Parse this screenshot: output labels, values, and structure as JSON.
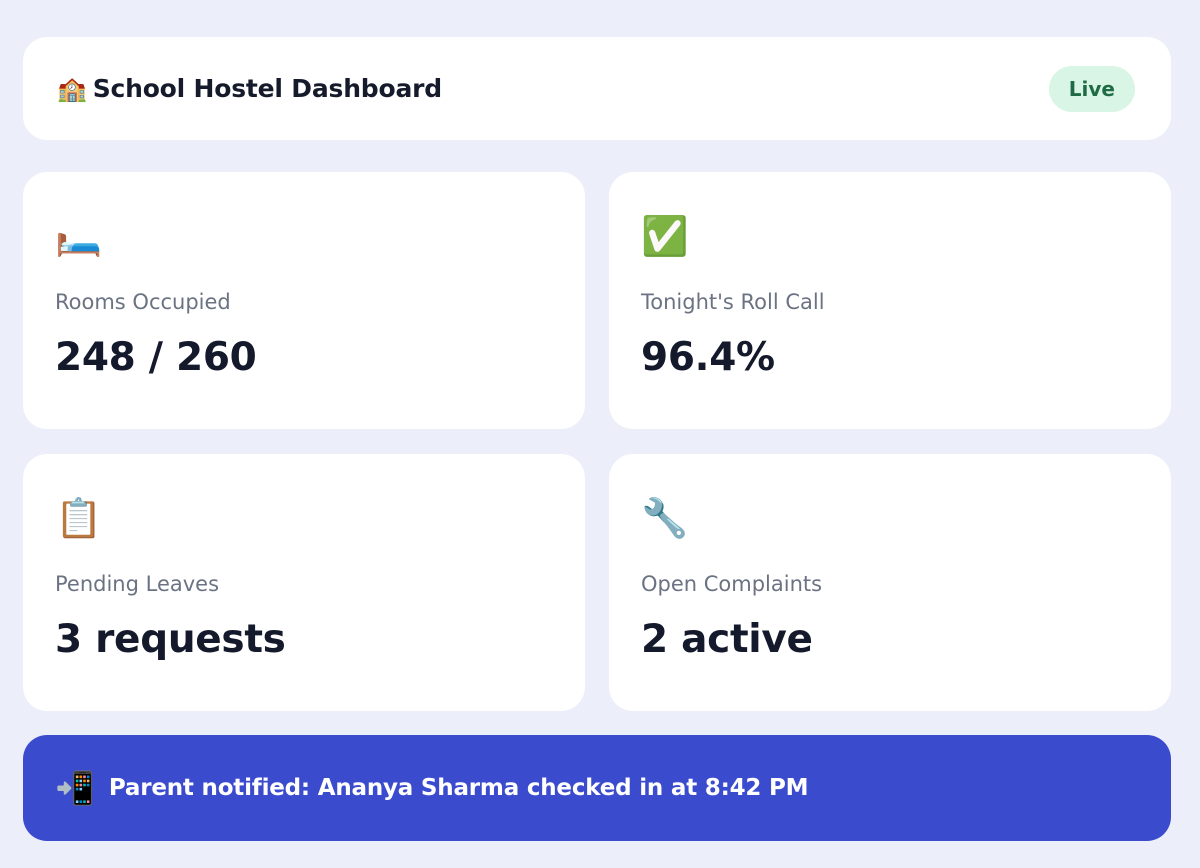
{
  "header": {
    "icon": "school-building-icon",
    "icon_glyph": "🏫",
    "title": "School Hostel Dashboard",
    "status_badge": "Live",
    "status_color": "#1f6b45",
    "status_bg": "#d8f5e5"
  },
  "cards": [
    {
      "icon": "bed-icon",
      "icon_glyph": "🛏️",
      "label": "Rooms Occupied",
      "value": "248 / 260"
    },
    {
      "icon": "check-mark-icon",
      "icon_glyph": "✅",
      "label": "Tonight's Roll Call",
      "value": "96.4%"
    },
    {
      "icon": "clipboard-icon",
      "icon_glyph": "📋",
      "label": "Pending Leaves",
      "value": "3 requests"
    },
    {
      "icon": "wrench-icon",
      "icon_glyph": "🔧",
      "label": "Open Complaints",
      "value": "2 active"
    }
  ],
  "notification": {
    "icon": "phone-incoming-icon",
    "icon_glyph": "📲",
    "text": "Parent notified: Ananya Sharma checked in at 8:42 PM",
    "background": "#3b4bce"
  },
  "colors": {
    "page_background": "#eceef9",
    "card_background": "#ffffff",
    "label_text": "#6b7383",
    "value_text": "#141a2b"
  }
}
